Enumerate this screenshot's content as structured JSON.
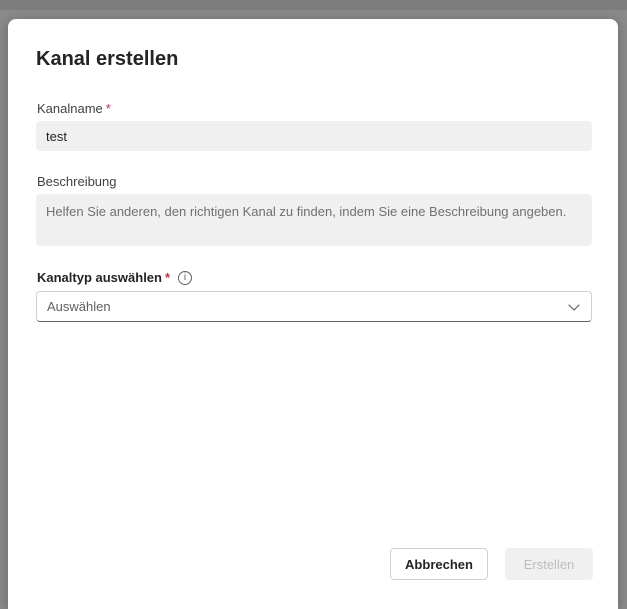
{
  "dialog": {
    "title": "Kanal erstellen",
    "channel_name": {
      "label": "Kanalname",
      "required_mark": "*",
      "value": "test"
    },
    "description": {
      "label": "Beschreibung",
      "placeholder": "Helfen Sie anderen, den richtigen Kanal zu finden, indem Sie eine Beschreibung angeben."
    },
    "channel_type": {
      "label": "Kanaltyp auswählen",
      "required_mark": "*",
      "info_icon_glyph": "i",
      "selected_value": "Auswählen"
    },
    "buttons": {
      "cancel_label": "Abbrechen",
      "create_label": "Erstellen",
      "create_enabled": false
    }
  },
  "colors": {
    "required": "#c4314b",
    "input_background": "#f0f0f0",
    "disabled_text": "#bdbdbd"
  },
  "icons": {
    "info": "info-icon",
    "dropdown": "chevron-down-icon"
  }
}
